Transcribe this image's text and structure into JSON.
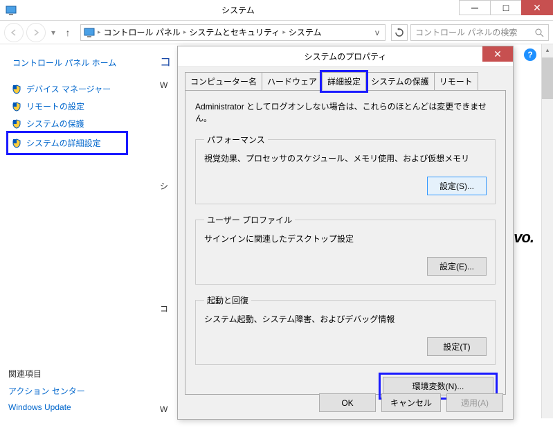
{
  "window": {
    "title": "システム",
    "min_label": "─",
    "max_label": "□",
    "close_label": "✕"
  },
  "breadcrumb": {
    "items": [
      "コントロール パネル",
      "システムとセキュリティ",
      "システム"
    ],
    "search_placeholder": "コントロール パネルの検索"
  },
  "sidebar": {
    "home_label": "コントロール パネル ホーム",
    "links": [
      {
        "label": "デバイス マネージャー"
      },
      {
        "label": "リモートの設定"
      },
      {
        "label": "システムの保護"
      },
      {
        "label": "システムの詳細設定"
      }
    ],
    "related_title": "関連項目",
    "related": [
      {
        "label": "アクション センター"
      },
      {
        "label": "Windows Update"
      }
    ]
  },
  "content": {
    "heading_prefix": "コ",
    "lines": [
      "W",
      "シ",
      "コ",
      "W"
    ]
  },
  "brand": "vo.",
  "dialog": {
    "title": "システムのプロパティ",
    "close_label": "✕",
    "tabs": [
      "コンピューター名",
      "ハードウェア",
      "詳細設定",
      "システムの保護",
      "リモート"
    ],
    "admin_note": "Administrator としてログオンしない場合は、これらのほとんどは変更できません。",
    "perf": {
      "legend": "パフォーマンス",
      "text": "視覚効果、プロセッサのスケジュール、メモリ使用、および仮想メモリ",
      "button": "設定(S)..."
    },
    "profile": {
      "legend": "ユーザー プロファイル",
      "text": "サインインに関連したデスクトップ設定",
      "button": "設定(E)..."
    },
    "startup": {
      "legend": "起動と回復",
      "text": "システム起動、システム障害、およびデバッグ情報",
      "button": "設定(T)"
    },
    "env_button": "環境変数(N)...",
    "ok": "OK",
    "cancel": "キャンセル",
    "apply": "適用(A)"
  }
}
